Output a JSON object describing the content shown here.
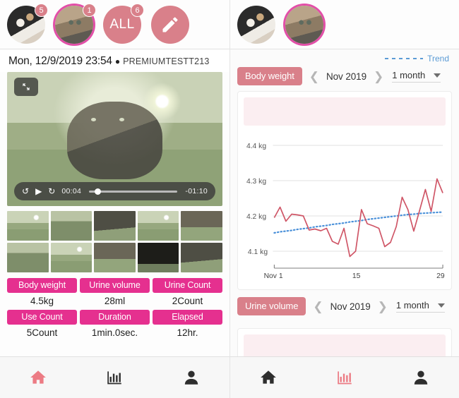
{
  "left_panel": {
    "avatars": [
      {
        "name": "cat-black",
        "badge": "5",
        "selected": false,
        "type": "photo"
      },
      {
        "name": "cat-tabby",
        "badge": "1",
        "selected": true,
        "type": "photo"
      },
      {
        "name": "all",
        "badge": "6",
        "selected": false,
        "type": "label",
        "label": "ALL"
      },
      {
        "name": "edit",
        "badge": "",
        "selected": false,
        "type": "icon",
        "icon": "pencil-icon"
      }
    ],
    "record": {
      "date": "Mon, 12/9/2019 23:54",
      "pin_icon": "location-pin-icon",
      "device": "PREMIUMTESTT213"
    },
    "video": {
      "expand_icon": "fullscreen-icon",
      "rewind_icon": "rewind-icon",
      "play_icon": "play-icon",
      "forward_icon": "forward-icon",
      "current_time": "00:04",
      "remaining_time": "-01:10",
      "progress_percent": 6
    },
    "thumbnails": [
      "frame-1",
      "frame-2",
      "frame-3",
      "frame-4",
      "frame-5",
      "frame-6",
      "frame-7",
      "frame-8",
      "frame-9",
      "frame-10"
    ],
    "stats": {
      "row1_labels": [
        "Body weight",
        "Urine volume",
        "Urine Count"
      ],
      "row1_values": [
        "4.5kg",
        "28ml",
        "2Count"
      ],
      "row2_labels": [
        "Use Count",
        "Duration",
        "Elapsed"
      ],
      "row2_values": [
        "5Count",
        "1min.0sec.",
        "12hr."
      ]
    },
    "nav": [
      {
        "name": "nav-home",
        "icon": "home-icon",
        "active": true
      },
      {
        "name": "nav-graph",
        "icon": "chart-icon",
        "active": false
      },
      {
        "name": "nav-account",
        "icon": "person-icon",
        "active": false
      }
    ]
  },
  "right_panel": {
    "avatars": [
      {
        "name": "cat-black",
        "badge": "",
        "selected": false,
        "type": "photo"
      },
      {
        "name": "cat-tabby",
        "badge": "",
        "selected": true,
        "type": "photo"
      }
    ],
    "legend": {
      "dash_icon": "dashed-line-icon",
      "label": "Trend"
    },
    "section1": {
      "metric_label": "Body weight",
      "prev_icon": "chevron-left-icon",
      "month": "Nov 2019",
      "next_icon": "chevron-right-icon",
      "range": "1 month",
      "caret_icon": "chevron-down-icon"
    },
    "section2": {
      "metric_label": "Urine volume",
      "prev_icon": "chevron-left-icon",
      "month": "Nov 2019",
      "next_icon": "chevron-right-icon",
      "range": "1 month",
      "caret_icon": "chevron-down-icon"
    },
    "nav": [
      {
        "name": "nav-home",
        "icon": "home-icon",
        "active": false
      },
      {
        "name": "nav-graph",
        "icon": "chart-icon",
        "active": true
      },
      {
        "name": "nav-account",
        "icon": "person-icon",
        "active": false
      }
    ]
  },
  "chart_data": {
    "type": "line",
    "title": "Body weight",
    "xlabel": "",
    "ylabel": "kg",
    "ylim": [
      4.05,
      4.45
    ],
    "yticks": [
      4.1,
      4.2,
      4.3,
      4.4
    ],
    "ytick_labels": [
      "4.1 kg",
      "4.2 kg",
      "4.3 kg",
      "4.4 kg"
    ],
    "xticks": [
      1,
      15,
      29
    ],
    "xtick_labels": [
      "Nov 1",
      "15",
      "29"
    ],
    "grid": true,
    "legend": [
      "Trend"
    ],
    "legend_position": "top-right",
    "x": [
      1,
      2,
      3,
      4,
      5,
      6,
      7,
      8,
      9,
      10,
      11,
      12,
      13,
      14,
      15,
      16,
      17,
      18,
      19,
      20,
      21,
      22,
      23,
      24,
      25,
      26,
      27,
      28,
      29,
      30
    ],
    "series": [
      {
        "name": "Body weight",
        "color": "#cf5566",
        "values": [
          4.195,
          4.225,
          4.185,
          4.205,
          4.203,
          4.2,
          4.16,
          4.163,
          4.158,
          4.165,
          4.128,
          4.12,
          4.165,
          4.085,
          4.1,
          4.218,
          4.178,
          4.172,
          4.165,
          4.113,
          4.125,
          4.17,
          4.253,
          4.218,
          4.157,
          4.215,
          4.275,
          4.213,
          4.305,
          4.265
        ]
      },
      {
        "name": "Trend",
        "color": "#4a90d9",
        "style": "dotted",
        "values": [
          4.152,
          4.155,
          4.157,
          4.159,
          4.162,
          4.164,
          4.166,
          4.169,
          4.171,
          4.173,
          4.176,
          4.178,
          4.18,
          4.183,
          4.185,
          4.187,
          4.19,
          4.192,
          4.194,
          4.196,
          4.198,
          4.2,
          4.202,
          4.204,
          4.205,
          4.207,
          4.208,
          4.209,
          4.21,
          4.211
        ]
      }
    ]
  }
}
